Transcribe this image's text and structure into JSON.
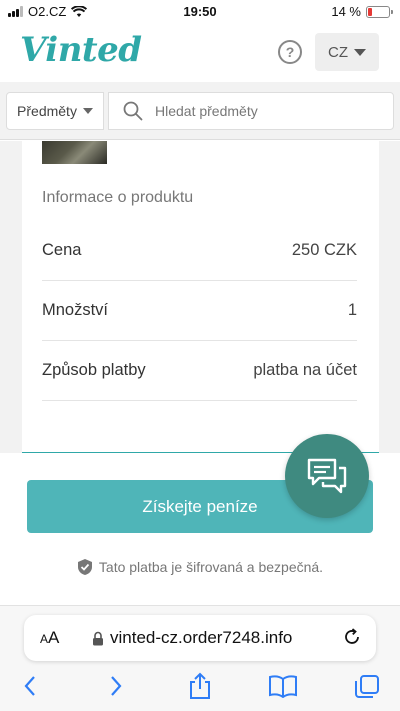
{
  "status": {
    "carrier": "O2.CZ",
    "time": "19:50",
    "battery": "14 %"
  },
  "header": {
    "logo": "Vinted",
    "help": "?",
    "language": "CZ"
  },
  "search": {
    "category": "Předměty",
    "placeholder": "Hledat předměty"
  },
  "product": {
    "section_title": "Informace o produktu",
    "rows": [
      {
        "label": "Cena",
        "value": "250 CZK"
      },
      {
        "label": "Množství",
        "value": "1"
      },
      {
        "label": "Způsob platby",
        "value": "platba na účet"
      }
    ]
  },
  "cta": {
    "label": "Získejte peníze"
  },
  "security_note": "Tato platba je šifrovaná a bezpečná.",
  "browser": {
    "aa_label_small": "A",
    "aa_label": "A",
    "url": "vinted-cz.order7248.info"
  },
  "colors": {
    "brand": "#2fa8a8",
    "cta": "#4fb5b8",
    "chat": "#3f8a80"
  }
}
